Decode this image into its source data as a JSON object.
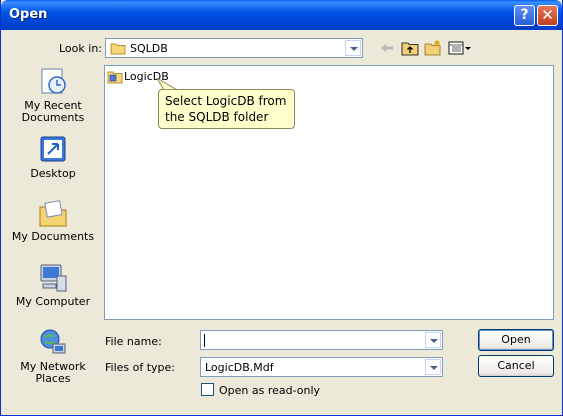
{
  "window": {
    "title": "Open"
  },
  "titlebar": {
    "help_label": "?",
    "close_label": "✕"
  },
  "lookin": {
    "label": "Look in:",
    "value": "SQLDB",
    "folder_icon": "folder-icon"
  },
  "toolbar": {
    "back_icon": "back-arrow-icon",
    "up_icon": "up-folder-icon",
    "new_folder_icon": "new-folder-icon",
    "views_icon": "views-menu-icon"
  },
  "places": [
    {
      "label_line1": "My Recent",
      "label_line2": "Documents",
      "icon": "recent-documents-icon"
    },
    {
      "label_line1": "Desktop",
      "label_line2": "",
      "icon": "desktop-icon"
    },
    {
      "label_line1": "My Documents",
      "label_line2": "",
      "icon": "my-documents-icon"
    },
    {
      "label_line1": "My Computer",
      "label_line2": "",
      "icon": "my-computer-icon"
    },
    {
      "label_line1": "My Network",
      "label_line2": "Places",
      "icon": "network-places-icon"
    }
  ],
  "files": [
    {
      "name": "LogicDB",
      "icon": "database-folder-icon"
    }
  ],
  "callout": {
    "line1": "Select LogicDB from",
    "line2": "the SQLDB folder"
  },
  "filename": {
    "label": "File name:",
    "value": ""
  },
  "filetype": {
    "label": "Files of type:",
    "value": "LogicDB.Mdf"
  },
  "readonly": {
    "label": "Open as read-only",
    "checked": false
  },
  "buttons": {
    "open": "Open",
    "cancel": "Cancel"
  }
}
